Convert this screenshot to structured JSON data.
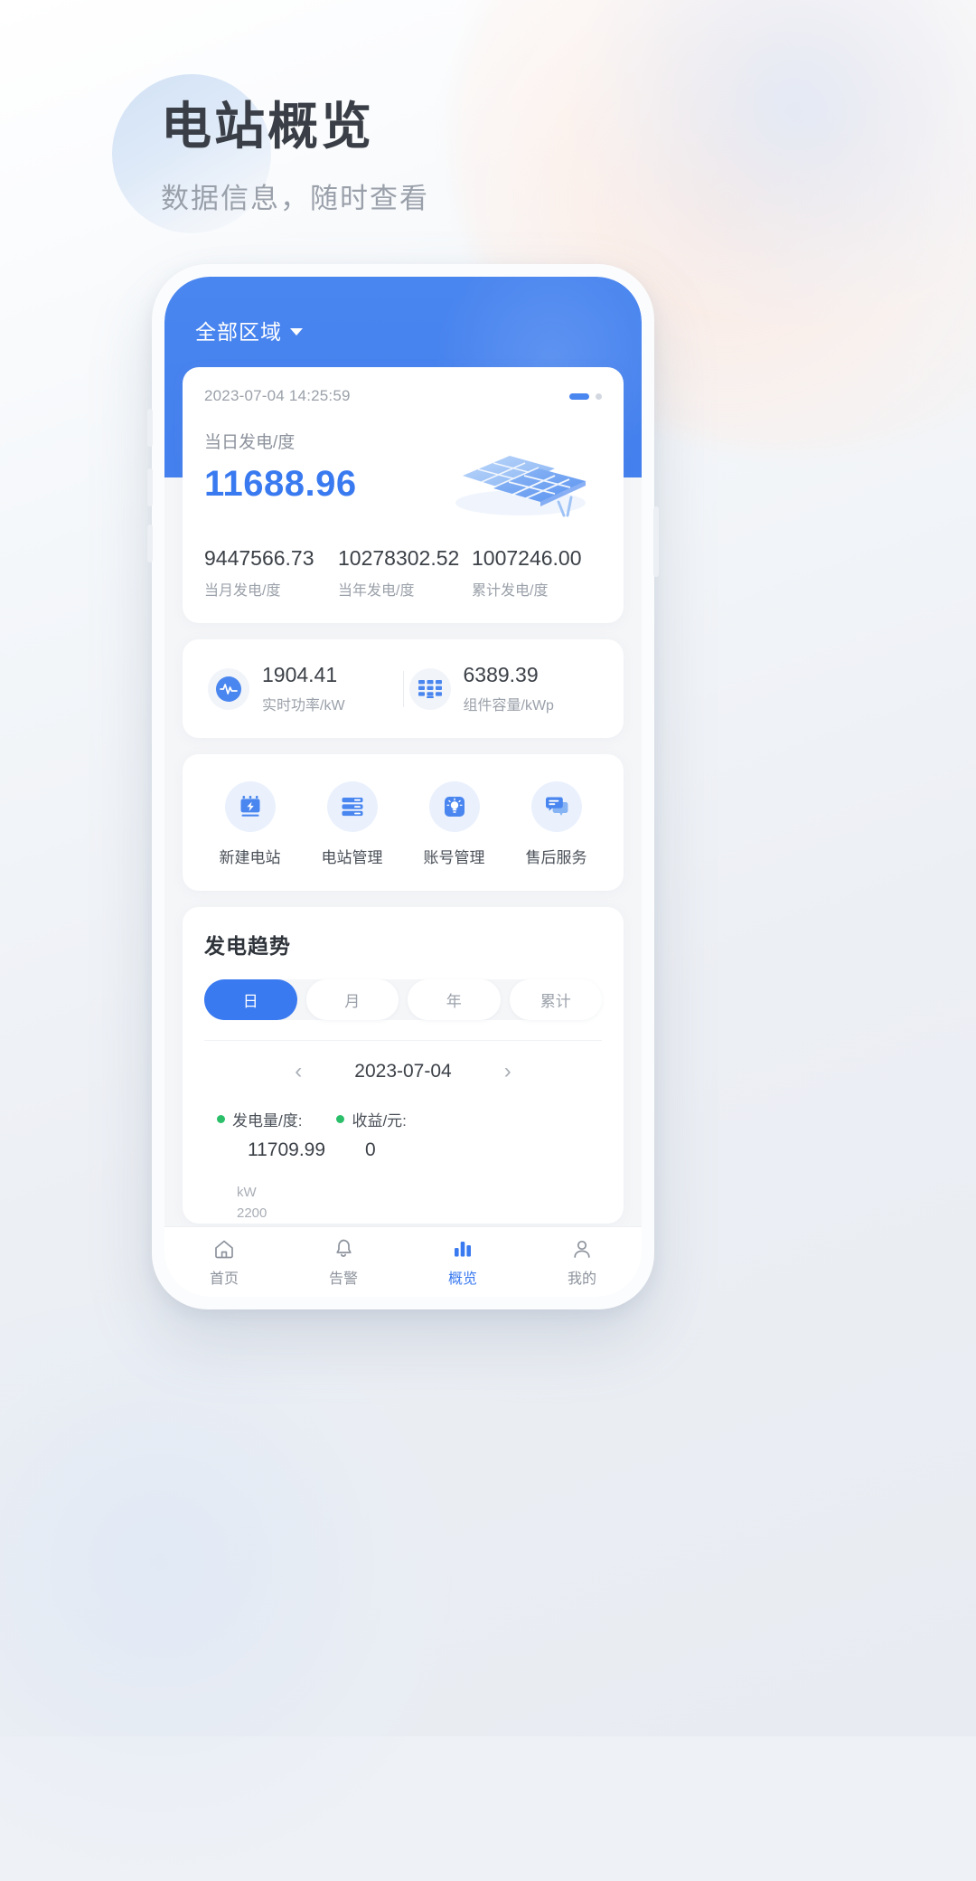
{
  "page": {
    "title": "电站概览",
    "subtitle": "数据信息，随时查看",
    "accent_color": "#3a7af0",
    "hero_color": "#4a86ef",
    "background_color": "#eef1f5"
  },
  "app": {
    "topbar": {
      "region_label": "全部区域",
      "caret_icon": "caret-down-icon"
    },
    "summary_card": {
      "timestamp": "2023-07-04 14:25:59",
      "today_label": "当日发电/度",
      "today_value": "11688.96",
      "carousel": {
        "active_index": 0,
        "count": 2
      },
      "illustration": "solar-panel-icon",
      "stats": [
        {
          "value": "9447566.73",
          "label": "当月发电/度"
        },
        {
          "value": "10278302.52",
          "label": "当年发电/度"
        },
        {
          "value": "1007246.00",
          "label": "累计发电/度"
        }
      ]
    },
    "metrics": [
      {
        "icon": "pulse-icon",
        "value": "1904.41",
        "label": "实时功率/kW"
      },
      {
        "icon": "solar-module-icon",
        "value": "6389.39",
        "label": "组件容量/kWp"
      }
    ],
    "quick_actions": [
      {
        "icon": "new-station-icon",
        "label": "新建电站"
      },
      {
        "icon": "station-manage-icon",
        "label": "电站管理"
      },
      {
        "icon": "account-manage-icon",
        "label": "账号管理"
      },
      {
        "icon": "after-sales-icon",
        "label": "售后服务"
      }
    ],
    "trend": {
      "title": "发电趋势",
      "tabs": [
        {
          "label": "日",
          "active": true
        },
        {
          "label": "月",
          "active": false
        },
        {
          "label": "年",
          "active": false
        },
        {
          "label": "累计",
          "active": false
        }
      ],
      "date_nav": {
        "prev_icon": "chevron-left-icon",
        "next_icon": "chevron-right-icon",
        "date": "2023-07-04"
      },
      "legend": [
        {
          "label": "发电量/度:",
          "value": "11709.99",
          "color": "#2bbf6a"
        },
        {
          "label": "收益/元:",
          "value": "0",
          "color": "#2bbf6a"
        }
      ],
      "axis_unit": "kW",
      "axis_top_tick": "2200"
    },
    "tabbar": [
      {
        "icon": "home-icon",
        "label": "首页",
        "active": false
      },
      {
        "icon": "bell-icon",
        "label": "告警",
        "active": false
      },
      {
        "icon": "chart-icon",
        "label": "概览",
        "active": true
      },
      {
        "icon": "person-icon",
        "label": "我的",
        "active": false
      }
    ]
  },
  "chart_data": {
    "type": "line",
    "title": "发电趋势",
    "xlabel": "",
    "ylabel": "kW",
    "ylim": [
      0,
      2200
    ],
    "date": "2023-07-04",
    "series": [
      {
        "name": "发电量/度",
        "total": 11709.99,
        "color": "#2bbf6a"
      },
      {
        "name": "收益/元",
        "total": 0,
        "color": "#2bbf6a"
      }
    ],
    "yticks": [
      2200
    ],
    "grid": false,
    "legend_position": "top"
  }
}
